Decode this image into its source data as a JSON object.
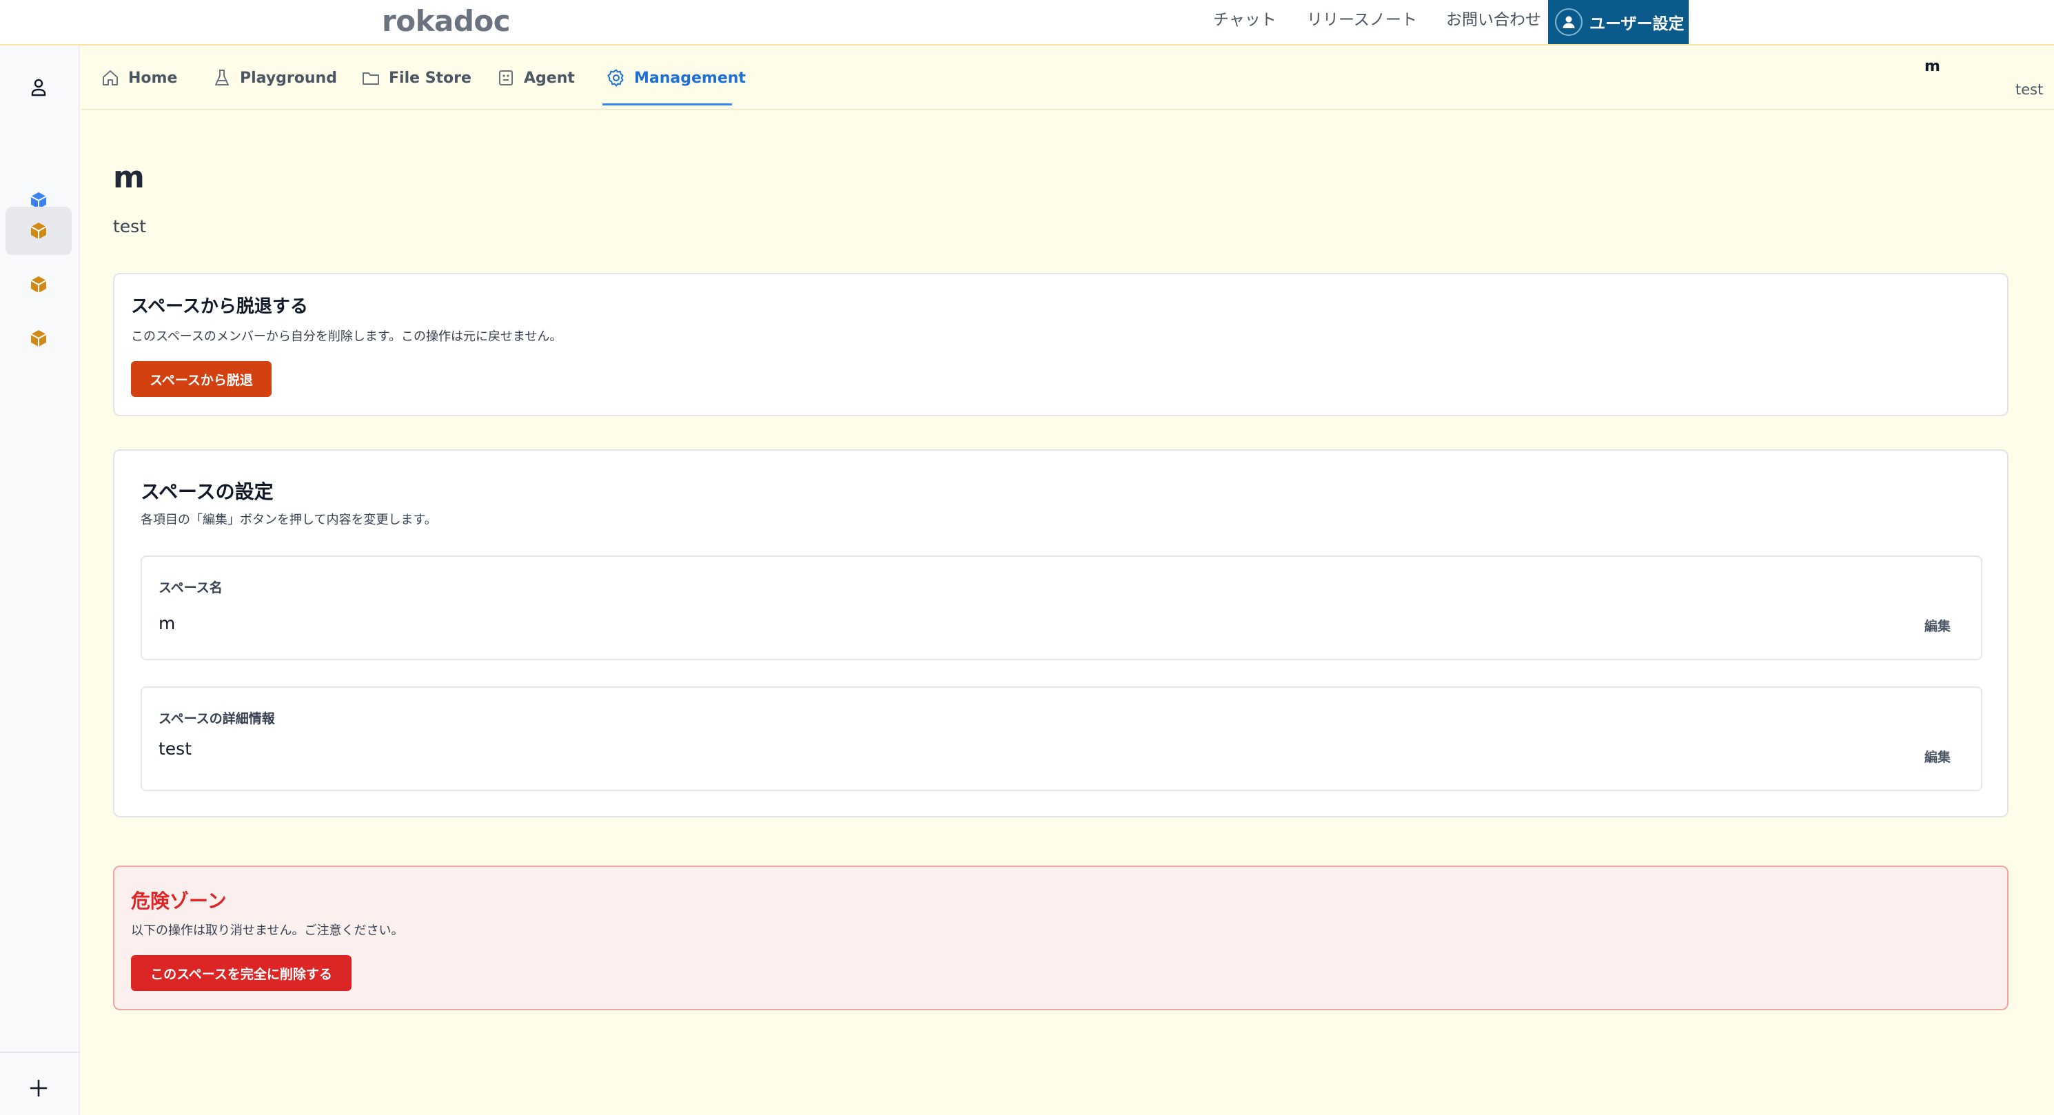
{
  "app": {
    "brand": "rokadoc"
  },
  "topnav": {
    "chat": "チャット",
    "release_notes": "リリースノート",
    "contact": "お問い合わせ",
    "user_settings": "ユーザー設定"
  },
  "tabs": [
    {
      "label": "Home",
      "icon": "home-icon"
    },
    {
      "label": "Playground",
      "icon": "flask-icon"
    },
    {
      "label": "File Store",
      "icon": "folder-icon"
    },
    {
      "label": "Agent",
      "icon": "agent-icon"
    },
    {
      "label": "Management",
      "icon": "gear-icon",
      "active": true
    }
  ],
  "space_header": {
    "name": "m",
    "description": "test"
  },
  "page": {
    "title": "m",
    "description": "test"
  },
  "leave_card": {
    "title": "スペースから脱退する",
    "text": "このスペースのメンバーから自分を削除します。この操作は元に戻せません。",
    "button": "スペースから脱退"
  },
  "settings_card": {
    "title": "スペースの設定",
    "text": "各項目の「編集」ボタンを押して内容を変更します。",
    "fields": [
      {
        "label": "スペース名",
        "value": "m",
        "edit": "編集"
      },
      {
        "label": "スペースの詳細情報",
        "value": "test",
        "edit": "編集"
      }
    ]
  },
  "danger_card": {
    "title": "危険ゾーン",
    "text": "以下の操作は取り消せません。ご注意ください。",
    "button": "このスペースを完全に削除する"
  },
  "colors": {
    "accent": "#1d6fd6",
    "user_button": "#0b5a8c",
    "leave_button": "#d2410f",
    "danger": "#dc2626",
    "page_bg": "#fefdea",
    "space_blue": "#3b82f6",
    "space_amber": "#d18a16"
  }
}
